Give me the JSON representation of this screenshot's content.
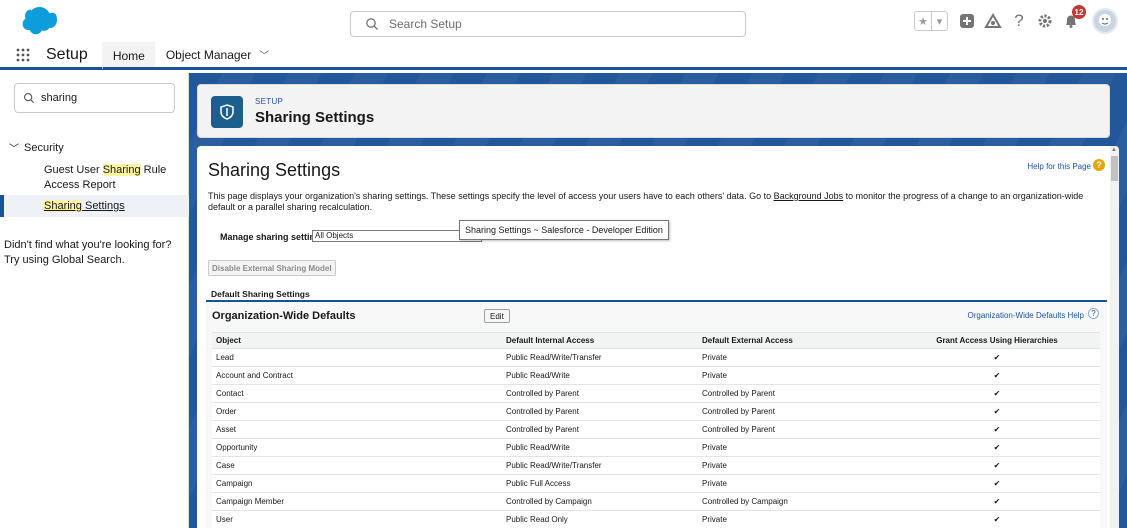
{
  "header": {
    "search_placeholder": "Search Setup",
    "notification_count": "12",
    "icons": [
      "favorites-star-icon",
      "favorites-dropdown-icon",
      "global-create-icon",
      "trailhead-icon",
      "help-icon",
      "setup-gear-icon",
      "notifications-bell-icon",
      "user-avatar"
    ]
  },
  "nav": {
    "app_name": "Setup",
    "tabs": [
      {
        "label": "Home",
        "active": true
      },
      {
        "label": "Object Manager",
        "active": false
      }
    ]
  },
  "sidebar": {
    "quick_find_value": "sharing",
    "section": "Security",
    "items": [
      {
        "pre": "Guest User ",
        "hl": "Sharing",
        "post": " Rule Access Report"
      },
      {
        "pre": "",
        "hl": "Sharing",
        "post": " Settings"
      }
    ],
    "not_found_text": "Didn't find what you're looking for? Try using Global Search."
  },
  "page_header": {
    "eyebrow": "SETUP",
    "title": "Sharing Settings"
  },
  "content": {
    "title": "Sharing Settings",
    "help_link": "Help for this Page",
    "description_pre": "This page displays your organization's sharing settings. These settings specify the level of access your users have to each others' data. Go to ",
    "description_link": "Background Jobs",
    "description_post": " to monitor the progress of a change to an organization-wide default or a parallel sharing recalculation.",
    "manage_label": "Manage sharing settings for:",
    "manage_value": "All Objects",
    "tooltip": "Sharing Settings ~ Salesforce - Developer Edition",
    "disable_button": "Disable External Sharing Model",
    "section_title": "Default Sharing Settings",
    "owd_title": "Organization-Wide Defaults",
    "edit_button": "Edit",
    "owd_help": "Organization-Wide Defaults Help",
    "columns": [
      "Object",
      "Default Internal Access",
      "Default External Access",
      "Grant Access Using Hierarchies"
    ],
    "check_glyph": "✔",
    "rows": [
      [
        "Lead",
        "Public Read/Write/Transfer",
        "Private",
        "✔"
      ],
      [
        "Account and Contract",
        "Public Read/Write",
        "Private",
        "✔"
      ],
      [
        "Contact",
        "Controlled by Parent",
        "Controlled by Parent",
        "✔"
      ],
      [
        "Order",
        "Controlled by Parent",
        "Controlled by Parent",
        "✔"
      ],
      [
        "Asset",
        "Controlled by Parent",
        "Controlled by Parent",
        "✔"
      ],
      [
        "Opportunity",
        "Public Read/Write",
        "Private",
        "✔"
      ],
      [
        "Case",
        "Public Read/Write/Transfer",
        "Private",
        "✔"
      ],
      [
        "Campaign",
        "Public Full Access",
        "Private",
        "✔"
      ],
      [
        "Campaign Member",
        "Controlled by Campaign",
        "Controlled by Campaign",
        "✔"
      ],
      [
        "User",
        "Public Read Only",
        "Private",
        "✔"
      ]
    ]
  }
}
